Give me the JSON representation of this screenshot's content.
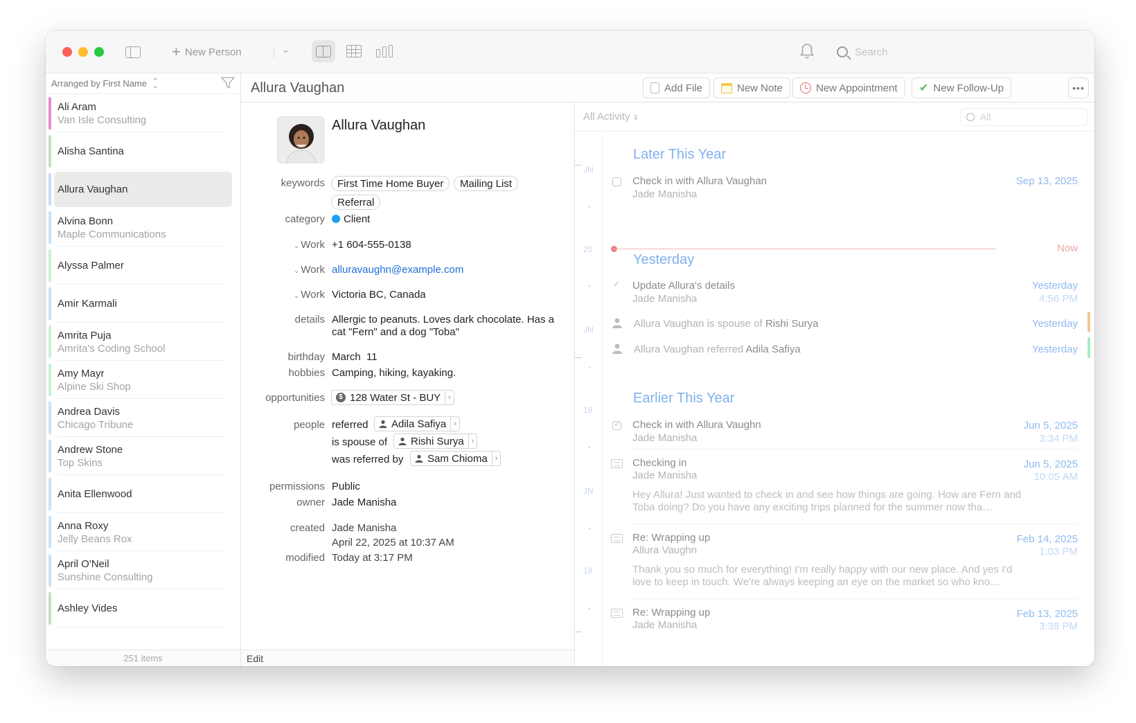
{
  "toolbar": {
    "new_person_label": "New Person",
    "search_placeholder": "Search"
  },
  "list": {
    "arranged_by": "Arranged by First Name",
    "footer": "251 items",
    "people": [
      {
        "name": "Ali Aram",
        "org": "Van Isle Consulting",
        "color": "#e98bd0"
      },
      {
        "name": "Alisha Santina",
        "org": "",
        "color": "#c9dcc4"
      },
      {
        "name": "Allura Vaughan",
        "org": "",
        "color": "#c9dcf6",
        "selected": true
      },
      {
        "name": "Alvina Bonn",
        "org": "Maple Communications",
        "color": "#c9e3f7"
      },
      {
        "name": "Alyssa Palmer",
        "org": "",
        "color": "#c9f0d6"
      },
      {
        "name": "Amir Karmali",
        "org": "",
        "color": "#c9e3f7"
      },
      {
        "name": "Amrita Puja",
        "org": "Amrita's Coding School",
        "color": "#c9f0d6"
      },
      {
        "name": "Amy Mayr",
        "org": "Alpine Ski Shop",
        "color": "#c9f0d6"
      },
      {
        "name": "Andrea Davis",
        "org": "Chicago Tribune",
        "color": "#c9e3f7"
      },
      {
        "name": "Andrew Stone",
        "org": "Top Skins",
        "color": "#c9e3f7"
      },
      {
        "name": "Anita Ellenwood",
        "org": "",
        "color": "#c9e3f7"
      },
      {
        "name": "Anna Roxy",
        "org": "Jelly Beans Rox",
        "color": "#c9e3f7"
      },
      {
        "name": "April O'Neil",
        "org": "Sunshine Consulting",
        "color": "#c9e3f7"
      },
      {
        "name": "Ashley Vides",
        "org": "",
        "color": "#c9dcc4"
      }
    ]
  },
  "detail": {
    "title": "Allura Vaughan",
    "actions": {
      "add_file": "Add File",
      "new_note": "New Note",
      "new_appointment": "New Appointment",
      "new_followup": "New Follow-Up"
    },
    "name": "Allura Vaughan",
    "labels": {
      "keywords": "keywords",
      "category": "category",
      "work": "Work",
      "details": "details",
      "birthday": "birthday",
      "hobbies": "hobbies",
      "opportunities": "opportunities",
      "people": "people",
      "permissions": "permissions",
      "owner": "owner",
      "created": "created",
      "modified": "modified"
    },
    "keywords": [
      "First Time Home Buyer",
      "Mailing List",
      "Referral"
    ],
    "category": "Client",
    "phone": "+1 604-555-0138",
    "email": "alluravaughn@example.com",
    "address": "Victoria BC, Canada",
    "details": "Allergic to peanuts. Loves dark chocolate. Has a cat \"Fern\" and a dog \"Toba\"",
    "birthday": "March  11",
    "hobbies": "Camping, hiking, kayaking.",
    "opportunity": "128 Water St - BUY",
    "relations": [
      {
        "relation": "referred",
        "person": "Adila Safiya"
      },
      {
        "relation": "is spouse of",
        "person": "Rishi Surya"
      },
      {
        "relation": "was referred by",
        "person": "Sam Chioma"
      }
    ],
    "permissions": "Public",
    "owner": "Jade Manisha",
    "created_by": "Jade Manisha",
    "created_at": "April 22, 2025 at 10:37 AM",
    "modified": "Today at 3:17 PM",
    "edit_label": "Edit"
  },
  "activity": {
    "filter": "All Activity",
    "search_placeholder": "All",
    "timeline_labels": [
      "JN",
      "20",
      "JN",
      "19",
      "JN",
      "18"
    ],
    "sections": {
      "later": "Later This Year",
      "yesterday": "Yesterday",
      "earlier": "Earlier This Year"
    },
    "now_label": "Now",
    "items": {
      "checkin_future": {
        "title": "Check in with Allura Vaughan",
        "sub": "Jade Manisha",
        "date": "Sep 13, 2025"
      },
      "update": {
        "title": "Update Allura's details",
        "sub": "Jade Manisha",
        "date": "Yesterday",
        "time": "4:56 PM"
      },
      "spouse": {
        "subject": "Allura Vaughan",
        "verb": "is spouse of",
        "object": "Rishi Surya",
        "date": "Yesterday"
      },
      "referred": {
        "subject": "Allura Vaughan",
        "verb": "referred",
        "object": "Adila Safiya",
        "date": "Yesterday"
      },
      "checkin_past": {
        "title": "Check in with Allura Vaughn",
        "sub": "Jade Manisha",
        "date": "Jun 5, 2025",
        "time": "3:34 PM"
      },
      "checking_in": {
        "title": "Checking in",
        "sub": "Jade Manisha",
        "date": "Jun 5, 2025",
        "time": "10:05 AM",
        "body": "Hey Allura! Just wanted to check in and see how things are going. How are Fern and Toba doing? Do you have any exciting trips planned for the summer now tha…"
      },
      "wrap1": {
        "title": "Re: Wrapping up",
        "sub": "Allura Vaughn",
        "date": "Feb 14, 2025",
        "time": "1:03 PM",
        "body": "Thank you so much for everything! I'm really happy with our new place. And yes I'd love to keep in touch. We're always keeping an eye on the market so who kno…"
      },
      "wrap2": {
        "title": "Re: Wrapping up",
        "sub": "Jade Manisha",
        "date": "Feb 13, 2025",
        "time": "3:38 PM"
      }
    },
    "colors": {
      "spouse_mark": "#f0c893",
      "referred_mark": "#a7ecc3"
    }
  }
}
